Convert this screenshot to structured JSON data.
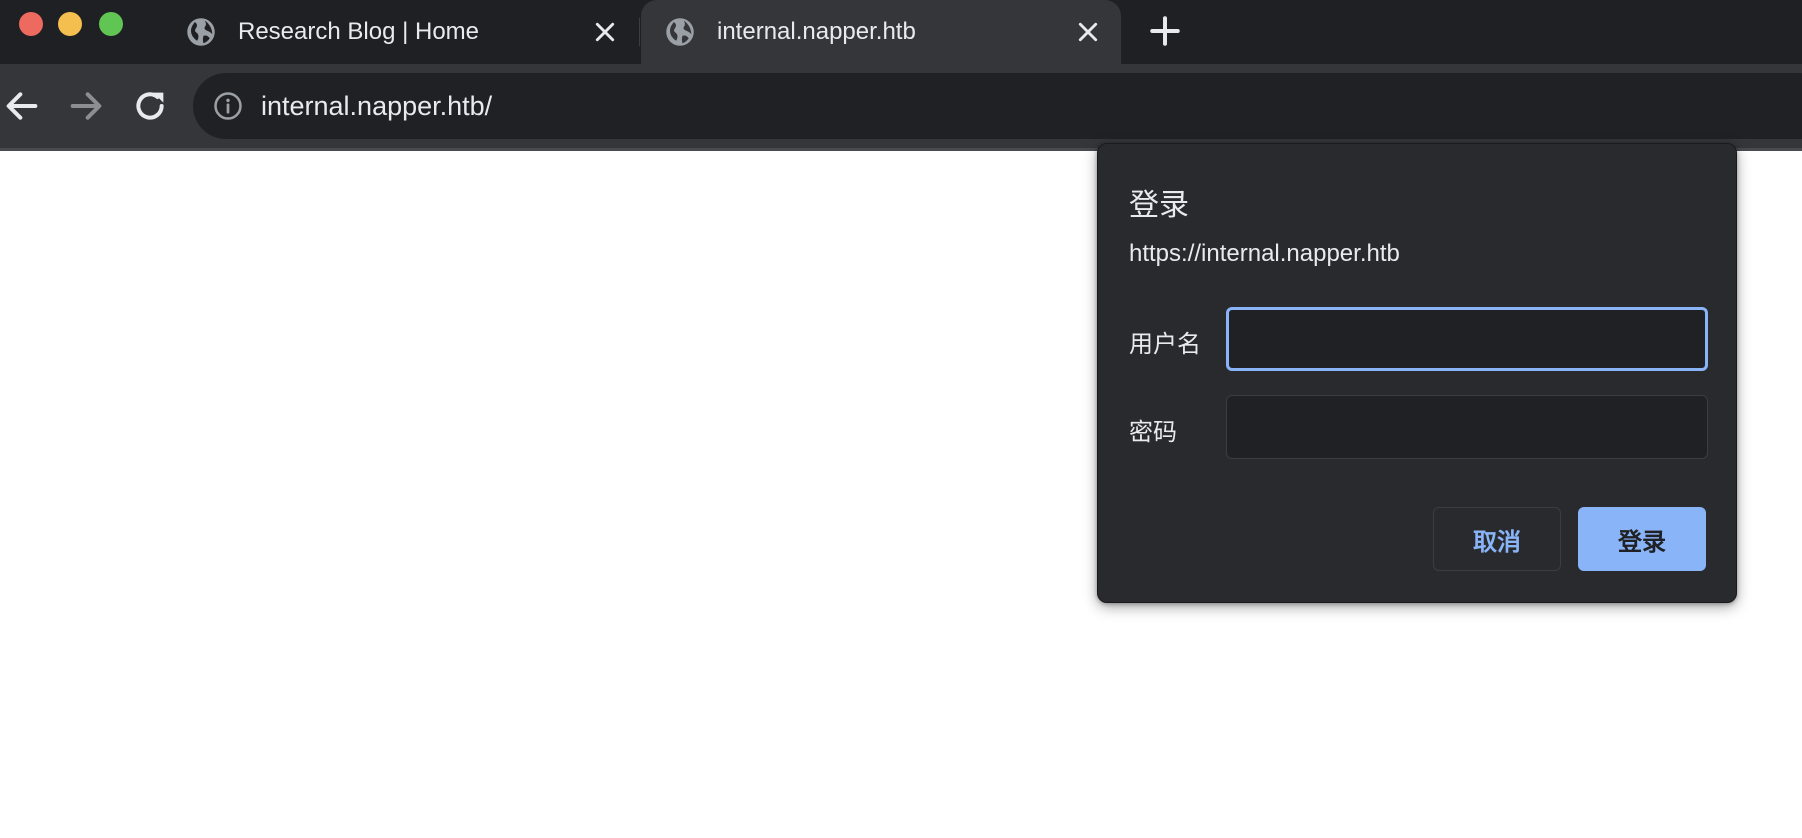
{
  "window": {
    "traffic_lights": [
      "#ed6a5e",
      "#f5bf4f",
      "#61c554"
    ]
  },
  "tabs": [
    {
      "title": "Research Blog | Home",
      "active": false,
      "icon": "globe-icon"
    },
    {
      "title": "internal.napper.htb",
      "active": true,
      "icon": "globe-icon"
    }
  ],
  "toolbar": {
    "url": "internal.napper.htb/"
  },
  "auth_dialog": {
    "title": "登录",
    "origin": "https://internal.napper.htb",
    "username_label": "用户名",
    "username_value": "",
    "password_label": "密码",
    "password_value": "",
    "cancel_label": "取消",
    "submit_label": "登录"
  },
  "colors": {
    "accent": "#8ab4f8",
    "dialog_bg": "#292a2d",
    "tab_strip_bg": "#1f2023",
    "toolbar_bg": "#35363a"
  }
}
